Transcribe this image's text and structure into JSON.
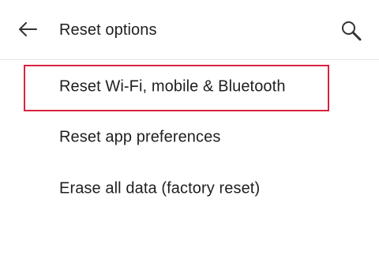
{
  "app_bar": {
    "title": "Reset options",
    "back_icon": "arrow-left-icon",
    "search_icon": "search-icon"
  },
  "options": [
    {
      "label": "Reset Wi-Fi, mobile & Bluetooth",
      "highlighted": true
    },
    {
      "label": "Reset app preferences",
      "highlighted": false
    },
    {
      "label": "Erase all data (factory reset)",
      "highlighted": false
    }
  ],
  "colors": {
    "text": "#1f1f1f",
    "divider": "#e4e4e4",
    "highlight": "#d8233d",
    "background": "#ffffff"
  }
}
